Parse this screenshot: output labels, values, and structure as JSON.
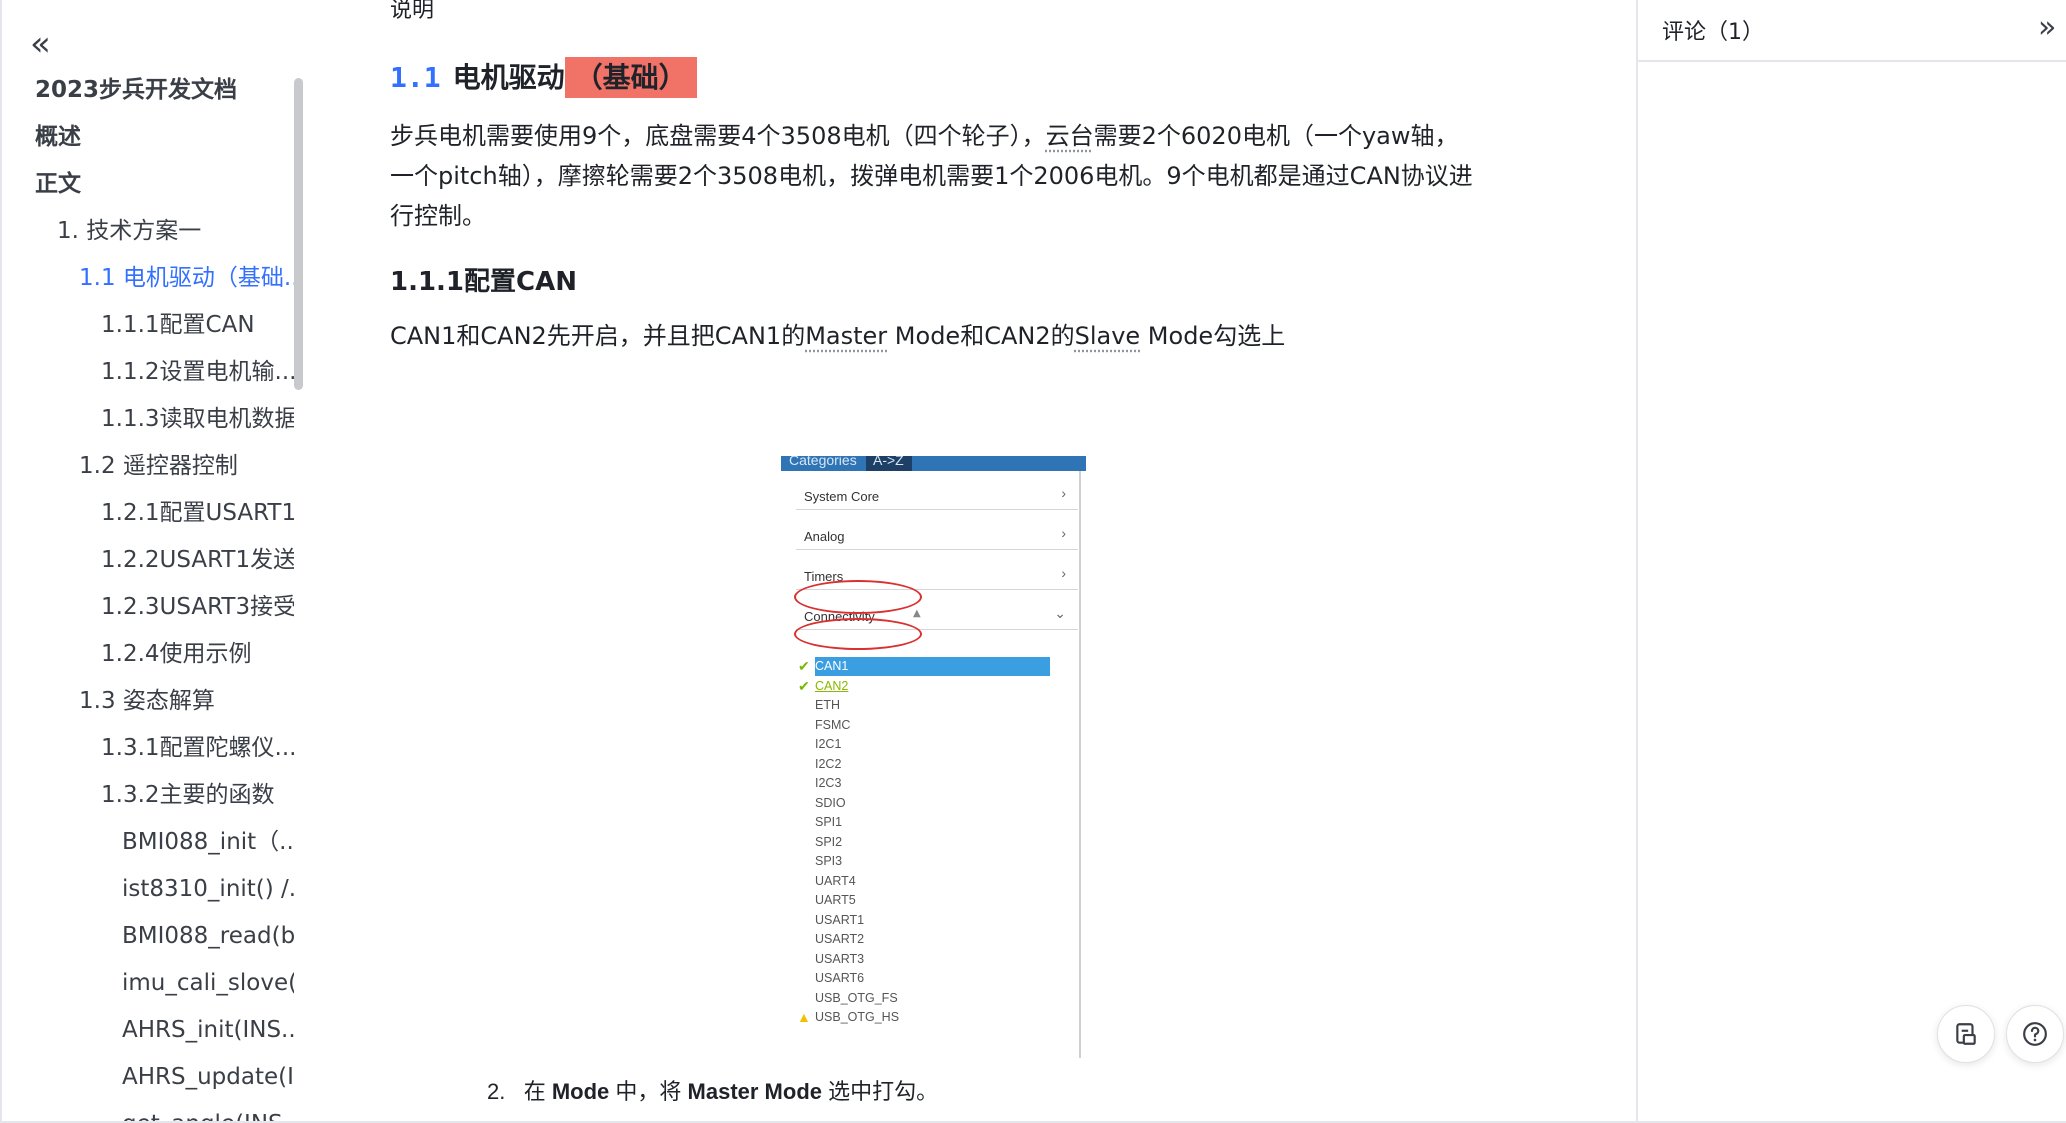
{
  "sidebar": {
    "collapse_icon": "double-chevron-left",
    "items": [
      {
        "label": "2023步兵开发文档",
        "level": "title"
      },
      {
        "label": "概述",
        "level": "section"
      },
      {
        "label": "正文",
        "level": "section"
      },
      {
        "label": "1. 技术方案一",
        "level": 1
      },
      {
        "label": "1.1 电机驱动（基础...",
        "level": 2,
        "active": true
      },
      {
        "label": "1.1.1配置CAN",
        "level": 3
      },
      {
        "label": "1.1.2设置电机输...",
        "level": 3
      },
      {
        "label": "1.1.3读取电机数据",
        "level": 3
      },
      {
        "label": "1.2 遥控器控制",
        "level": 2
      },
      {
        "label": "1.2.1配置USART1...",
        "level": 3
      },
      {
        "label": "1.2.2USART1发送...",
        "level": 3
      },
      {
        "label": "1.2.3USART3接受...",
        "level": 3
      },
      {
        "label": "1.2.4使用示例",
        "level": 3
      },
      {
        "label": "1.3 姿态解算",
        "level": 2
      },
      {
        "label": "1.3.1配置陀螺仪...",
        "level": 3
      },
      {
        "label": "1.3.2主要的函数",
        "level": 3
      },
      {
        "label": "BMI088_init（...",
        "level": 4
      },
      {
        "label": "ist8310_init() /...",
        "level": 4
      },
      {
        "label": "BMI088_read(b...",
        "level": 4
      },
      {
        "label": "imu_cali_slove(...",
        "level": 4
      },
      {
        "label": "AHRS_init(INS...",
        "level": 4
      },
      {
        "label": "AHRS_update(I...",
        "level": 4
      },
      {
        "label": "get_angle(INS...",
        "level": 4
      }
    ]
  },
  "main": {
    "top_text": "说明",
    "heading": {
      "number": "1.1",
      "text": "电机驱动",
      "highlight": "（基础）"
    },
    "paragraph1": {
      "part1": "步兵电机需要使用9个，底盘需要4个3508电机（四个轮子），",
      "underlined1": "云台",
      "part2": "需要2个6020电机（一个yaw轴，",
      "line2": "一个pitch轴），摩擦轮需要2个3508电机，拨弹电机需要1个2006电机。9个电机都是通过CAN协议进",
      "line3": "行控制。"
    },
    "subheading": "1.1.1配置CAN",
    "paragraph2": {
      "part1": "CAN1和CAN2先开启，并且把CAN1的",
      "underlined1": "Master",
      "part2": " Mode和CAN2的",
      "underlined2": "Slave",
      "part3": " Mode勾选上"
    },
    "image": {
      "tabs": [
        "Categories",
        "A->Z"
      ],
      "categories": [
        {
          "label": "System Core",
          "state": "collapsed"
        },
        {
          "label": "Analog",
          "state": "collapsed"
        },
        {
          "label": "Timers",
          "state": "collapsed"
        },
        {
          "label": "Connectivity",
          "state": "expanded"
        }
      ],
      "peripherals": [
        {
          "label": "CAN1",
          "status": "checked",
          "selected": true
        },
        {
          "label": "CAN2",
          "status": "checked"
        },
        {
          "label": "ETH"
        },
        {
          "label": "FSMC"
        },
        {
          "label": "I2C1"
        },
        {
          "label": "I2C2"
        },
        {
          "label": "I2C3"
        },
        {
          "label": "SDIO"
        },
        {
          "label": "SPI1"
        },
        {
          "label": "SPI2"
        },
        {
          "label": "SPI3"
        },
        {
          "label": "UART4"
        },
        {
          "label": "UART5"
        },
        {
          "label": "USART1"
        },
        {
          "label": "USART2"
        },
        {
          "label": "USART3"
        },
        {
          "label": "USART6"
        },
        {
          "label": "USB_OTG_FS"
        },
        {
          "label": "USB_OTG_HS",
          "status": "warning"
        }
      ],
      "step": {
        "number": "2.",
        "pre": "在 ",
        "mode": "Mode",
        "mid": " 中，将 ",
        "master": "Master Mode",
        "post": " 选中打勾。"
      }
    }
  },
  "comments": {
    "title": "评论（1）",
    "collapse_icon": "double-chevron-right",
    "fab_icons": [
      "document-icon",
      "help-icon"
    ]
  },
  "colors": {
    "accent": "#3370ff",
    "highlight": "#f17267",
    "selected_row": "#3a9ee0",
    "oval": "#d93030"
  }
}
